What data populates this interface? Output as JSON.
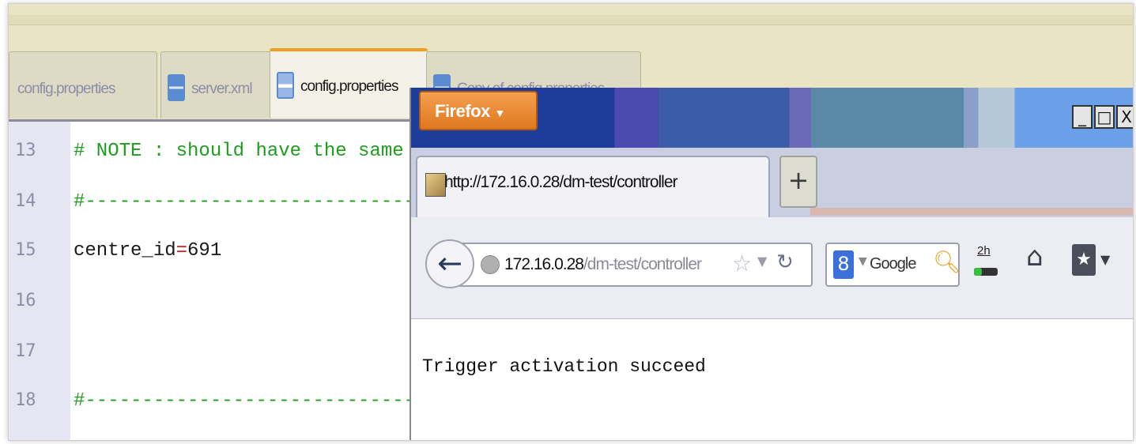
{
  "editor": {
    "tabs": [
      {
        "label": "config.properties",
        "active": false
      },
      {
        "label": "server.xml",
        "active": false
      },
      {
        "label": "config.properties",
        "active": true
      },
      {
        "label": "Copy of config.properties",
        "active": false
      }
    ],
    "lines": [
      {
        "number": "13",
        "text": "# NOTE : should have the same"
      },
      {
        "number": "14",
        "text": "#---------------------------------------"
      },
      {
        "number": "15",
        "key": "centre_id",
        "operator": "=",
        "value": "691"
      },
      {
        "number": "16",
        "text": ""
      },
      {
        "number": "17",
        "text": ""
      },
      {
        "number": "18",
        "text": "#---------------------------------------"
      }
    ]
  },
  "firefox": {
    "menu_button": "Firefox",
    "menu_arrow": "▼",
    "window_controls": {
      "minimize": "_",
      "maximize": "□",
      "close": "X"
    },
    "tab_title": "http://172.16.0.28/dm-test/controller",
    "new_tab": "+",
    "url_host": "172.16.0.28",
    "url_path": "/dm-test/controller",
    "search_engine": "Google",
    "search_logo": "8",
    "downloads_text": "2h",
    "page_text": "Trigger activation succeed"
  },
  "colors": {
    "comment_green": "#1e9e1e",
    "operator_red": "#d02020",
    "active_tab_accent": "#f0a020",
    "firefox_orange": "#e07820"
  }
}
